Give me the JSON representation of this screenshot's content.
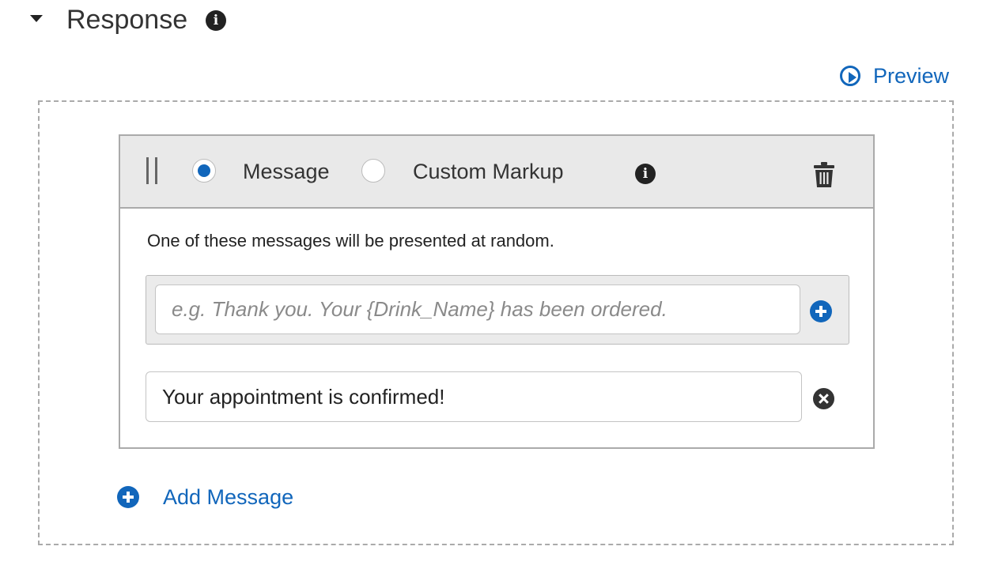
{
  "section": {
    "title": "Response",
    "info_icon": "info-icon",
    "caret_icon": "caret-down-icon"
  },
  "preview": {
    "label": "Preview",
    "icon": "play-circle-icon"
  },
  "card": {
    "drag_icon": "drag-handle-icon",
    "response_type": {
      "options": [
        {
          "label": "Message",
          "selected": true
        },
        {
          "label": "Custom Markup",
          "selected": false
        }
      ]
    },
    "info_icon": "info-icon",
    "delete_icon": "trash-icon",
    "hint": "One of these messages will be presented at random.",
    "new_message": {
      "value": "",
      "placeholder": "e.g. Thank you. Your {Drink_Name} has been ordered.",
      "add_icon": "plus-circle-icon"
    },
    "messages": [
      {
        "value": "Your appointment is confirmed!",
        "remove_icon": "close-circle-icon"
      }
    ]
  },
  "add_message": {
    "label": "Add Message",
    "icon": "plus-circle-icon"
  },
  "colors": {
    "accent": "#1166bb",
    "header_bg": "#e9e9e9",
    "border": "#aaaaaa",
    "text": "#333333"
  }
}
